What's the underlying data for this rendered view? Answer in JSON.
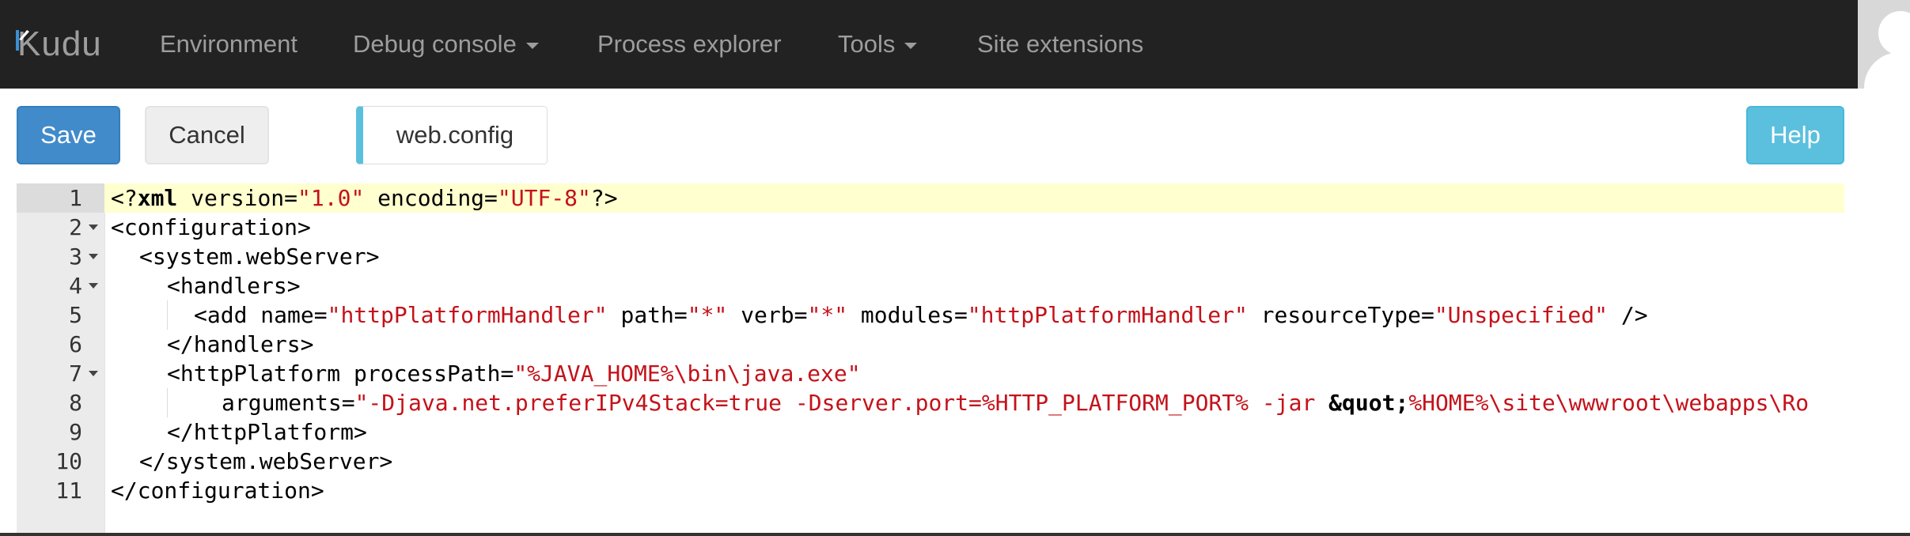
{
  "navbar": {
    "brand": "Kudu",
    "items": [
      {
        "label": "Environment",
        "dropdown": false
      },
      {
        "label": "Debug console",
        "dropdown": true
      },
      {
        "label": "Process explorer",
        "dropdown": false
      },
      {
        "label": "Tools",
        "dropdown": true
      },
      {
        "label": "Site extensions",
        "dropdown": false
      }
    ]
  },
  "toolbar": {
    "save_label": "Save",
    "cancel_label": "Cancel",
    "file_name": "web.config",
    "help_label": "Help"
  },
  "editor": {
    "active_line": 1,
    "lines": [
      {
        "number": "1",
        "fold": false
      },
      {
        "number": "2",
        "fold": true
      },
      {
        "number": "3",
        "fold": true
      },
      {
        "number": "4",
        "fold": true
      },
      {
        "number": "5",
        "fold": false
      },
      {
        "number": "6",
        "fold": false
      },
      {
        "number": "7",
        "fold": true
      },
      {
        "number": "8",
        "fold": false
      },
      {
        "number": "9",
        "fold": false
      },
      {
        "number": "10",
        "fold": false
      },
      {
        "number": "11",
        "fold": false
      }
    ],
    "code": {
      "l1": {
        "open": "<?",
        "xml": "xml",
        "attr1": " version=",
        "val1": "\"1.0\"",
        "attr2": " encoding=",
        "val2": "\"UTF-8\"",
        "close": "?>"
      },
      "l2": {
        "text": "<configuration>"
      },
      "l3": {
        "text": "<system.webServer>"
      },
      "l4": {
        "text": "<handlers>"
      },
      "l5": {
        "tag": "<add",
        "a1": " name=",
        "v1": "\"httpPlatformHandler\"",
        "a2": " path=",
        "v2": "\"*\"",
        "a3": " verb=",
        "v3": "\"*\"",
        "a4": " modules=",
        "v4": "\"httpPlatformHandler\"",
        "a5": " resourceType=",
        "v5": "\"Unspecified\"",
        "close": " />"
      },
      "l6": {
        "text": "</handlers>"
      },
      "l7": {
        "tag": "<httpPlatform",
        "a1": " processPath=",
        "v1": "\"%JAVA_HOME%\\bin\\java.exe\""
      },
      "l8": {
        "a1": "arguments=",
        "v1a": "\"-Djava.net.preferIPv4Stack=true -Dserver.port=%HTTP_PLATFORM_PORT% -jar ",
        "entity": "&quot;",
        "v1b": "%HOME%\\site\\wwwroot\\webapps\\Ro"
      },
      "l9": {
        "text": "</httpPlatform>"
      },
      "l10": {
        "text": "</system.webServer>"
      },
      "l11": {
        "text": "</configuration>"
      }
    }
  },
  "colors": {
    "navbar_bg": "#222222",
    "save_button": "#428bca",
    "help_button": "#5bc0de",
    "string": "#c4121a",
    "active_line": "#ffffd0"
  }
}
